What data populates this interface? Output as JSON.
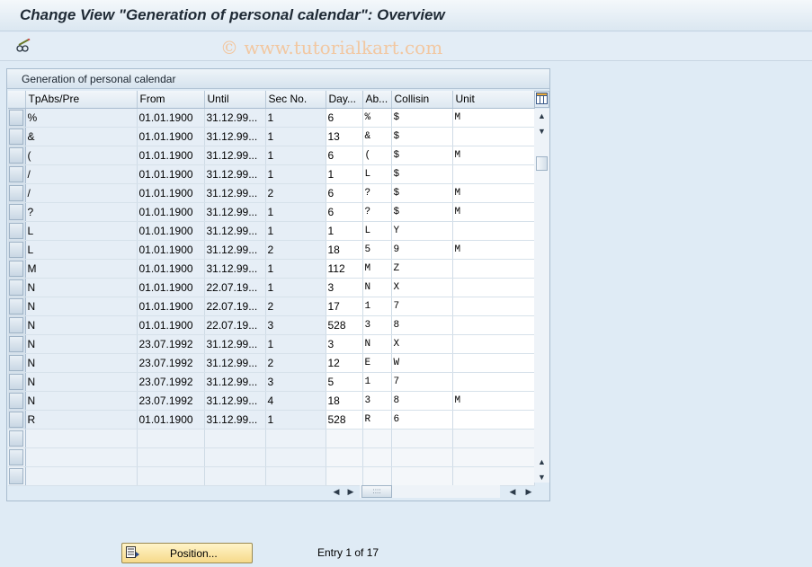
{
  "window": {
    "title": "Change View \"Generation of personal calendar\": Overview"
  },
  "toolbar": {
    "edit_icon": "pencil-glasses-icon",
    "watermark": "© www.tutorialkart.com"
  },
  "panel": {
    "title": "Generation of personal calendar"
  },
  "table": {
    "columns": [
      "TpAbs/Pre",
      "From",
      "Until",
      "Sec No.",
      "Day...",
      "Ab...",
      "Collisin",
      "Unit"
    ],
    "rows": [
      [
        "%",
        "01.01.1900",
        "31.12.99...",
        "1",
        "6",
        "%",
        "$",
        "M"
      ],
      [
        "&",
        "01.01.1900",
        "31.12.99...",
        "1",
        "13",
        "&",
        "$",
        ""
      ],
      [
        "(",
        "01.01.1900",
        "31.12.99...",
        "1",
        "6",
        "(",
        "$",
        "M"
      ],
      [
        "/",
        "01.01.1900",
        "31.12.99...",
        "1",
        "1",
        "L",
        "$",
        ""
      ],
      [
        "/",
        "01.01.1900",
        "31.12.99...",
        "2",
        "6",
        "?",
        "$",
        "M"
      ],
      [
        "?",
        "01.01.1900",
        "31.12.99...",
        "1",
        "6",
        "?",
        "$",
        "M"
      ],
      [
        "L",
        "01.01.1900",
        "31.12.99...",
        "1",
        "1",
        "L",
        "Y",
        ""
      ],
      [
        "L",
        "01.01.1900",
        "31.12.99...",
        "2",
        "18",
        "5",
        "9",
        "M"
      ],
      [
        "M",
        "01.01.1900",
        "31.12.99...",
        "1",
        "112",
        "M",
        "Z",
        ""
      ],
      [
        "N",
        "01.01.1900",
        "22.07.19...",
        "1",
        "3",
        "N",
        "X",
        ""
      ],
      [
        "N",
        "01.01.1900",
        "22.07.19...",
        "2",
        "17",
        "1",
        "7",
        ""
      ],
      [
        "N",
        "01.01.1900",
        "22.07.19...",
        "3",
        "528",
        "3",
        "8",
        ""
      ],
      [
        "N",
        "23.07.1992",
        "31.12.99...",
        "1",
        "3",
        "N",
        "X",
        ""
      ],
      [
        "N",
        "23.07.1992",
        "31.12.99...",
        "2",
        "12",
        "E",
        "W",
        ""
      ],
      [
        "N",
        "23.07.1992",
        "31.12.99...",
        "3",
        "5",
        "1",
        "7",
        ""
      ],
      [
        "N",
        "23.07.1992",
        "31.12.99...",
        "4",
        "18",
        "3",
        "8",
        "M"
      ],
      [
        "R",
        "01.01.1900",
        "31.12.99...",
        "1",
        "528",
        "R",
        "6",
        ""
      ]
    ],
    "empty_rows": 3
  },
  "footer": {
    "position_label": "Position...",
    "entry_text": "Entry 1 of 17"
  },
  "colors": {
    "background": "#dfebf5",
    "button": "#f6d98a"
  }
}
